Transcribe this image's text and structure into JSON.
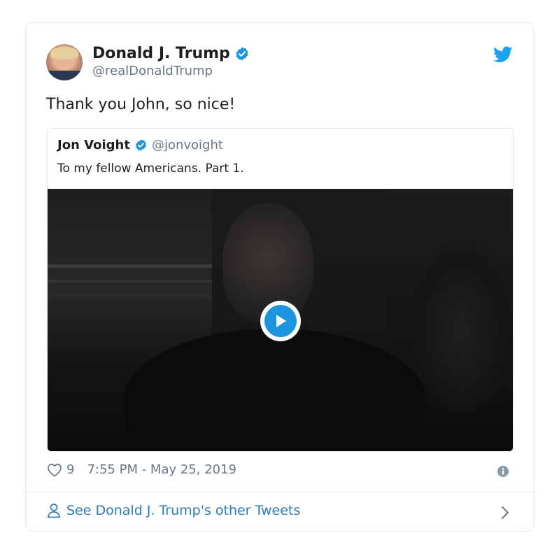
{
  "tweet": {
    "author_name": "Donald J. Trump",
    "author_handle": "@realDonaldTrump",
    "text": "Thank you John, so nice!",
    "likes": "9",
    "timestamp": "7:55 PM - May 25, 2019"
  },
  "quoted": {
    "author_name": "Jon Voight",
    "author_handle": "@jonvoight",
    "text": "To my fellow Americans. Part 1."
  },
  "footer": {
    "link_text": "See Donald J. Trump's other Tweets"
  },
  "icons": {
    "brand": "twitter-bird-icon",
    "verified": "verified-badge-icon",
    "play": "play-icon",
    "like": "heart-icon",
    "info": "info-icon",
    "person": "person-icon",
    "chevron": "chevron-right-icon"
  },
  "colors": {
    "accent": "#1da1f2",
    "verified": "#1b95e0",
    "link": "#2b7bb9",
    "text": "#1c2022",
    "muted": "#697882",
    "border": "#e1e8ed"
  }
}
